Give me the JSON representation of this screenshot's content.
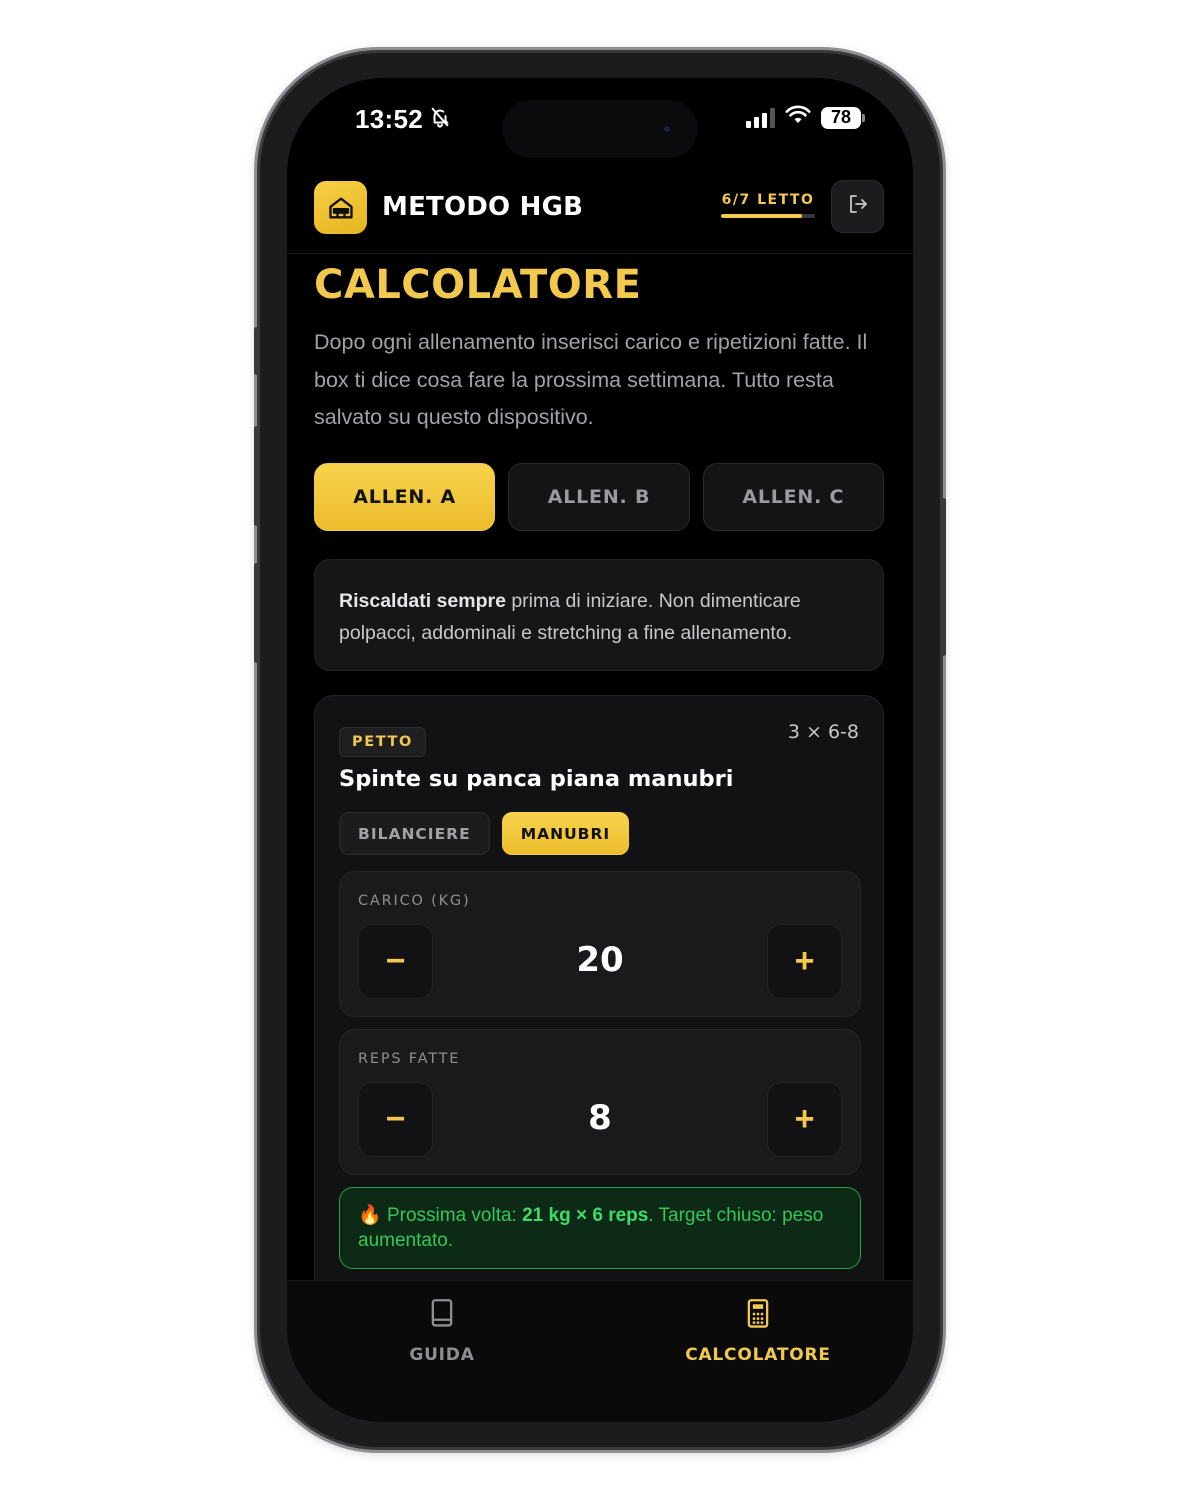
{
  "status_bar": {
    "time": "13:52",
    "battery": "78"
  },
  "header": {
    "brand": "METODO HGB",
    "progress_label": "6/7 LETTO",
    "progress_fraction": 0.857
  },
  "page": {
    "title": "CALCOLATORE",
    "description": "Dopo ogni allenamento inserisci carico e ripetizioni fatte. Il box ti dice cosa fare la prossima settimana. Tutto resta salvato su questo dispositivo."
  },
  "tabs": [
    {
      "label": "ALLEN. A",
      "active": true
    },
    {
      "label": "ALLEN. B",
      "active": false
    },
    {
      "label": "ALLEN. C",
      "active": false
    }
  ],
  "notice": {
    "strong": "Riscaldati sempre",
    "text": " prima di iniziare. Non dimenticare polpacci, addominali e stretching a fine allenamento."
  },
  "exercise": {
    "muscle": "PETTO",
    "scheme": "3 × 6-8",
    "name": "Spinte su panca piana manubri",
    "equipment": [
      {
        "label": "BILANCIERE",
        "active": false
      },
      {
        "label": "MANUBRI",
        "active": true
      }
    ],
    "load": {
      "label": "CARICO (KG)",
      "value": "20",
      "minus": "−",
      "plus": "+"
    },
    "reps": {
      "label": "REPS FATTE",
      "value": "8",
      "minus": "−",
      "plus": "+"
    },
    "suggestion": {
      "icon": "🔥",
      "prefix": "Prossima volta: ",
      "strong": "21 kg × 6 reps",
      "suffix": ". Target chiuso: peso aumentato."
    }
  },
  "bottom_nav": [
    {
      "label": "GUIDA",
      "icon": "book-icon",
      "active": false
    },
    {
      "label": "CALCOLATORE",
      "icon": "calculator-icon",
      "active": true
    }
  ],
  "colors": {
    "accent": "#f2c94c",
    "success": "#34c759",
    "background": "#000000"
  }
}
